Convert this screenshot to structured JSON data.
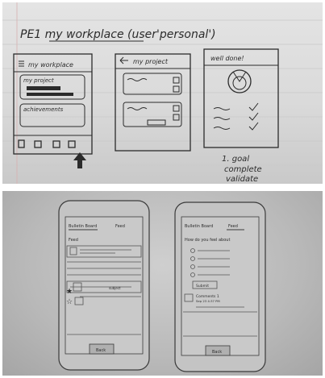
{
  "top_sketch": {
    "title": "PE1 my workplace (user'personal')",
    "screen1": {
      "header": "my workplace",
      "card1_label": "my project",
      "card2_label": "achievements"
    },
    "screen2": {
      "header": "my project"
    },
    "screen3": {
      "header": "well done!",
      "note_line1": "1. goal",
      "note_line2": "complete",
      "note_line3": "validate"
    }
  },
  "bottom_sketch": {
    "left_phone": {
      "tab1": "Bulletin Board",
      "tab2": "Feed",
      "section": "Feed",
      "item_text": "subject",
      "bottom_button": "Back"
    },
    "right_phone": {
      "tab1": "Bulletin Board",
      "tab2": "Feed",
      "question": "How do you feel about",
      "submit": "Submit",
      "comment_title": "Comments 1",
      "comment_text": "Sep 23 4:37 PM",
      "bottom_button": "Back"
    }
  }
}
